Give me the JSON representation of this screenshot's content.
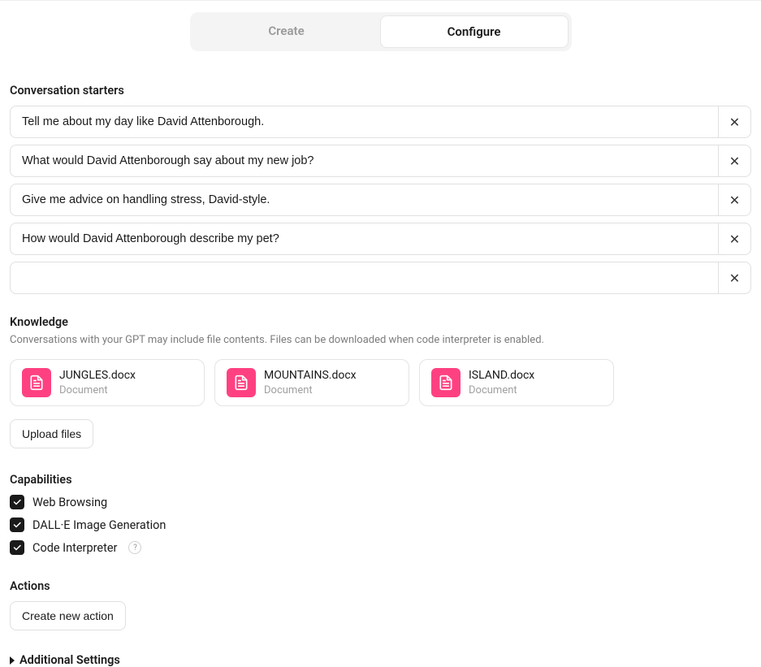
{
  "tabs": {
    "create": "Create",
    "configure": "Configure"
  },
  "starters": {
    "label": "Conversation starters",
    "items": [
      "Tell me about my day like David Attenborough.",
      "What would David Attenborough say about my new job?",
      "Give me advice on handling stress, David-style.",
      "How would David Attenborough describe my pet?",
      ""
    ]
  },
  "knowledge": {
    "label": "Knowledge",
    "description": "Conversations with your GPT may include file contents. Files can be downloaded when code interpreter is enabled.",
    "files": [
      {
        "name": "JUNGLES.docx",
        "type": "Document"
      },
      {
        "name": "MOUNTAINS.docx",
        "type": "Document"
      },
      {
        "name": "ISLAND.docx",
        "type": "Document"
      }
    ],
    "upload_label": "Upload files"
  },
  "capabilities": {
    "label": "Capabilities",
    "items": [
      {
        "label": "Web Browsing",
        "checked": true,
        "help": false
      },
      {
        "label": "DALL·E Image Generation",
        "checked": true,
        "help": false
      },
      {
        "label": "Code Interpreter",
        "checked": true,
        "help": true
      }
    ]
  },
  "actions": {
    "label": "Actions",
    "create_label": "Create new action"
  },
  "additional_label": "Additional Settings",
  "icons": {
    "doc": "document-icon",
    "check": "check-icon",
    "close": "close-icon"
  },
  "colors": {
    "accent": "#ff4182"
  }
}
